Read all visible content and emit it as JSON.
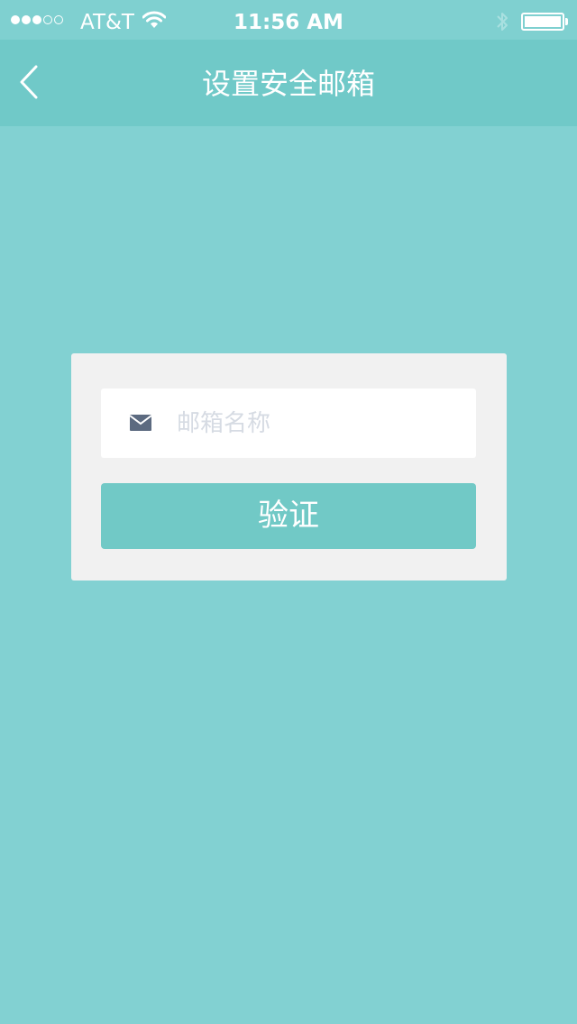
{
  "status_bar": {
    "signal_bars_filled": 3,
    "signal_bars_total": 5,
    "carrier": "AT&T",
    "time": "11:56 AM",
    "battery_level": 1.0
  },
  "nav": {
    "back_icon": "chevron-left-icon",
    "title": "设置安全邮箱"
  },
  "form": {
    "email_icon": "mail-icon",
    "email_placeholder": "邮箱名称",
    "email_value": "",
    "verify_label": "验证"
  },
  "colors": {
    "background": "#82d1d2",
    "nav_bar": "#70c9c8",
    "card": "#f1f1f1",
    "button": "#71c9c6",
    "icon": "#5c6a80"
  }
}
